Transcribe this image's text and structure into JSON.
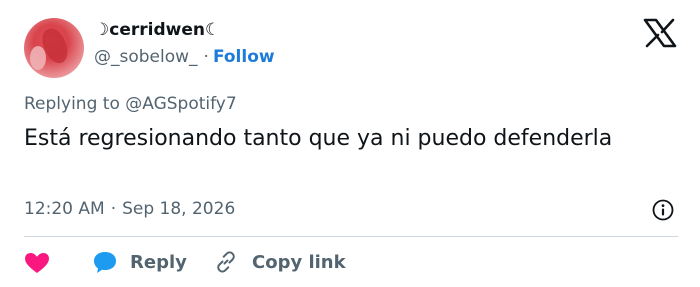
{
  "user": {
    "display_name": "☽cerridwen☾",
    "handle": "@_sobelow_",
    "separator": "·",
    "follow_label": "Follow"
  },
  "tweet": {
    "replying_to": "Replying to @AGSpotify7",
    "text": "Está regresionando tanto que ya ni puedo defenderla",
    "time": "12:20 AM",
    "separator": "·",
    "date": "Sep 18, 2026"
  },
  "actions": {
    "like_icon": "heart-icon",
    "reply_label": "Reply",
    "copy_link_label": "Copy link"
  },
  "colors": {
    "accent": "#1d7bd9",
    "heart": "#f91880",
    "muted": "#536471",
    "text": "#0f1419"
  }
}
